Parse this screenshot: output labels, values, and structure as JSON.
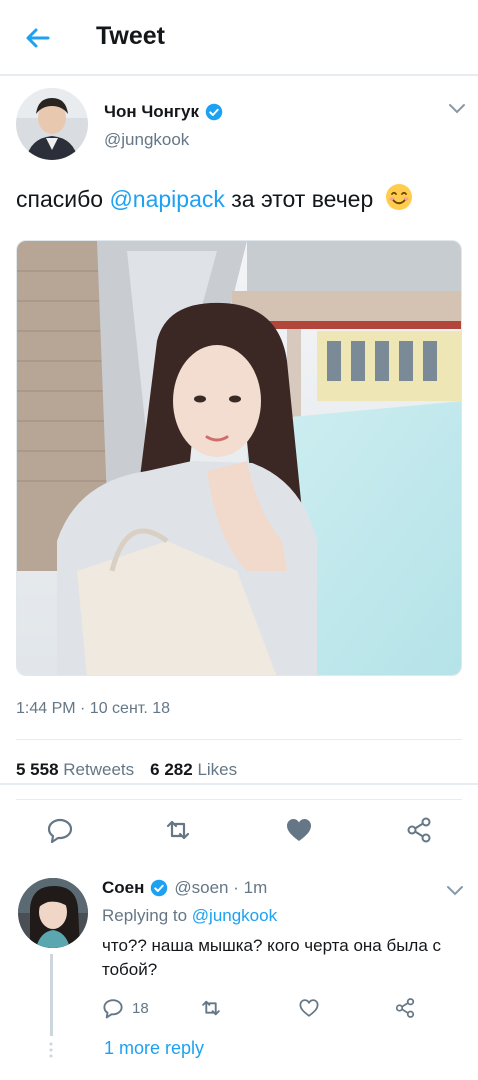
{
  "header": {
    "title": "Tweet",
    "back_icon": "arrow-left-icon"
  },
  "tweet": {
    "author_name": "Чон Чонгук",
    "author_handle": "@jungkook",
    "verified": true,
    "text_before": "спасибо ",
    "mention": "@napipack",
    "text_after": " за этот вечер",
    "emoji": "smiling-face-emoji",
    "timestamp": "1:44 PM · 10 сент. 18",
    "retweets_count": "5 558",
    "retweets_label": "Retweets",
    "likes_count": "6 282",
    "likes_label": "Likes",
    "actions": [
      "reply-icon",
      "retweet-icon",
      "like-icon",
      "share-icon"
    ]
  },
  "reply": {
    "name": "Соен",
    "handle": "@soen · 1m",
    "verified": true,
    "replying_prefix": "Replying to ",
    "replying_to": "@jungkook",
    "text": "что?? наша мышка? кого черта она была с тобой?",
    "reply_count": "18",
    "more_replies": "1 more reply"
  },
  "colors": {
    "accent": "#1da1f2",
    "text": "#14171a",
    "secondary": "#657786",
    "border": "#e6ecf0"
  }
}
